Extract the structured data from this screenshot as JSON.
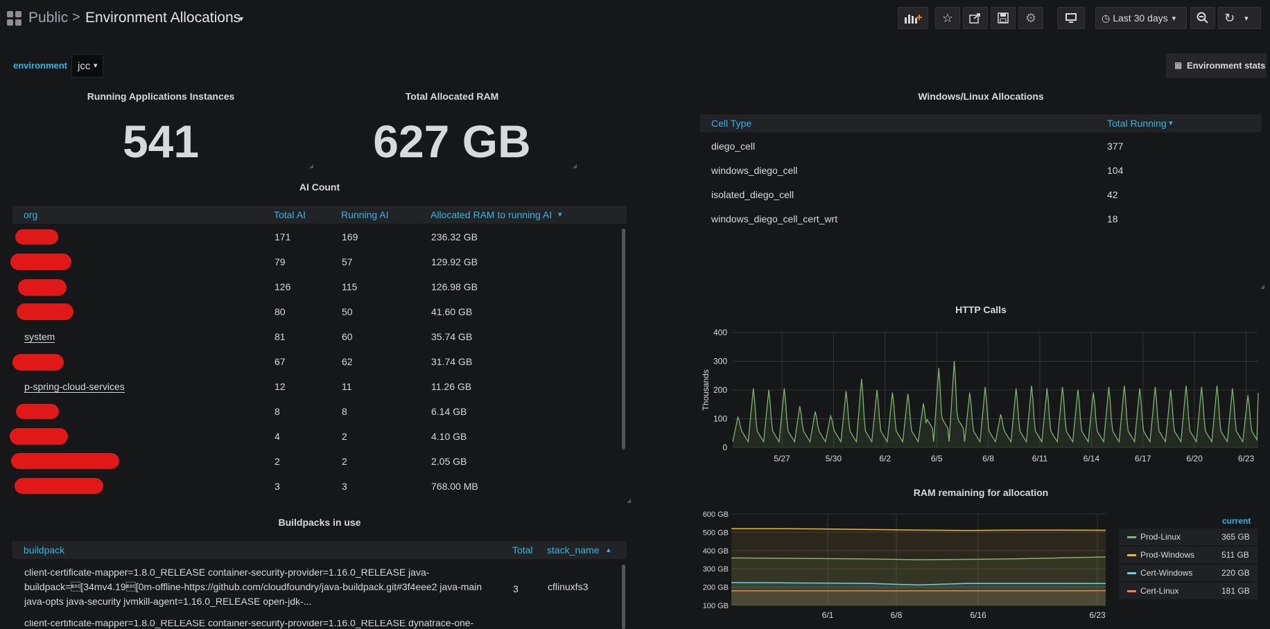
{
  "header": {
    "breadcrumb_root": "Public",
    "separator": ">",
    "title": "Environment Allocations",
    "time_range": "Last 30 days"
  },
  "variables": {
    "environment_label": "environment",
    "environment_value": "jcc"
  },
  "environment_stats_button": "Environment stats",
  "stats": [
    {
      "title": "Running Applications Instances",
      "value": "541"
    },
    {
      "title": "Total Allocated RAM",
      "value": "627 GB"
    }
  ],
  "ai_table": {
    "title": "AI Count",
    "columns": [
      "org",
      "Total AI",
      "Running AI",
      "Allocated RAM to running AI"
    ],
    "rows": [
      {
        "org": "",
        "total": "171",
        "running": "169",
        "ram": "236.32 GB"
      },
      {
        "org": "",
        "total": "79",
        "running": "57",
        "ram": "129.92 GB"
      },
      {
        "org": "",
        "total": "126",
        "running": "115",
        "ram": "126.98 GB"
      },
      {
        "org": "",
        "total": "80",
        "running": "50",
        "ram": "41.60 GB"
      },
      {
        "org": "system",
        "total": "81",
        "running": "60",
        "ram": "35.74 GB"
      },
      {
        "org": "",
        "total": "67",
        "running": "62",
        "ram": "31.74 GB"
      },
      {
        "org": "p-spring-cloud-services",
        "total": "12",
        "running": "11",
        "ram": "11.26 GB"
      },
      {
        "org": "",
        "total": "8",
        "running": "8",
        "ram": "6.14 GB"
      },
      {
        "org": "",
        "total": "4",
        "running": "2",
        "ram": "4.10 GB"
      },
      {
        "org": "",
        "total": "2",
        "running": "2",
        "ram": "2.05 GB"
      },
      {
        "org": "",
        "total": "3",
        "running": "3",
        "ram": "768.00 MB"
      }
    ]
  },
  "buildpacks": {
    "title": "Buildpacks in use",
    "columns": [
      "buildpack",
      "Total",
      "stack_name"
    ],
    "row1": {
      "line1": "client-certificate-mapper=1.8.0_RELEASE container-security-provider=1.16.0_RELEASE java-",
      "line2": "buildpack=\u001b[34mv4.19\u001b[0m-offline-https://github.com/cloudfoundry/java-buildpack.git#3f4eee2 java-main",
      "line3": "java-opts java-security jvmkill-agent=1.16.0_RELEASE open-jdk-...",
      "total": "3",
      "stack": "cflinuxfs3"
    },
    "row2_partial": "client-certificate-mapper=1.8.0_RELEASE container-security-provider=1.16.0_RELEASE dynatrace-one-"
  },
  "cell_table": {
    "title": "Windows/Linux Allocations",
    "columns": [
      "Cell Type",
      "Total Running"
    ],
    "rows": [
      {
        "type": "diego_cell",
        "total": "377"
      },
      {
        "type": "windows_diego_cell",
        "total": "104"
      },
      {
        "type": "isolated_diego_cell",
        "total": "42"
      },
      {
        "type": "windows_diego_cell_cert_wrt",
        "total": "18"
      }
    ]
  },
  "chart_data": [
    {
      "type": "line",
      "title": "HTTP Calls",
      "ylabel": "Thousands",
      "ylim": [
        0,
        400
      ],
      "yticks": [
        "0",
        "100",
        "200",
        "300",
        "400"
      ],
      "xticks": [
        "5/27",
        "5/30",
        "6/2",
        "6/5",
        "6/8",
        "6/11",
        "6/14",
        "6/17",
        "6/20",
        "6/23"
      ],
      "series": [
        {
          "color": "#7eb26d",
          "peaks": [
            110,
            215,
            210,
            215,
            150,
            130,
            115,
            205,
            250,
            210,
            200,
            195,
            160,
            290,
            315,
            200,
            220,
            120,
            215,
            225,
            215,
            220,
            210,
            200,
            220,
            225,
            215,
            220,
            210,
            225,
            220,
            225,
            215,
            190
          ]
        }
      ]
    },
    {
      "type": "line",
      "title": "RAM remaining for allocation",
      "ylim": [
        100,
        600
      ],
      "yticks": [
        "100 GB",
        "200 GB",
        "300 GB",
        "400 GB",
        "500 GB",
        "600 GB"
      ],
      "xticks": [
        "6/1",
        "6/8",
        "6/16",
        "6/23"
      ],
      "legend_header": "current",
      "series": [
        {
          "name": "Prod-Linux",
          "current": "365 GB",
          "color": "#7eb26d",
          "values": [
            360,
            358,
            356,
            354,
            350,
            352,
            355,
            360,
            365
          ]
        },
        {
          "name": "Prod-Windows",
          "current": "511 GB",
          "color": "#eab839",
          "values": [
            520,
            520,
            518,
            515,
            512,
            510,
            512,
            512,
            511
          ]
        },
        {
          "name": "Cert-Windows",
          "current": "220 GB",
          "color": "#6ed0e0",
          "values": [
            225,
            224,
            222,
            220,
            212,
            220,
            220,
            220,
            220
          ]
        },
        {
          "name": "Cert-Linux",
          "current": "181 GB",
          "color": "#ef843c",
          "values": [
            180,
            180,
            180,
            180,
            180,
            180,
            180,
            180,
            181
          ]
        }
      ]
    }
  ]
}
